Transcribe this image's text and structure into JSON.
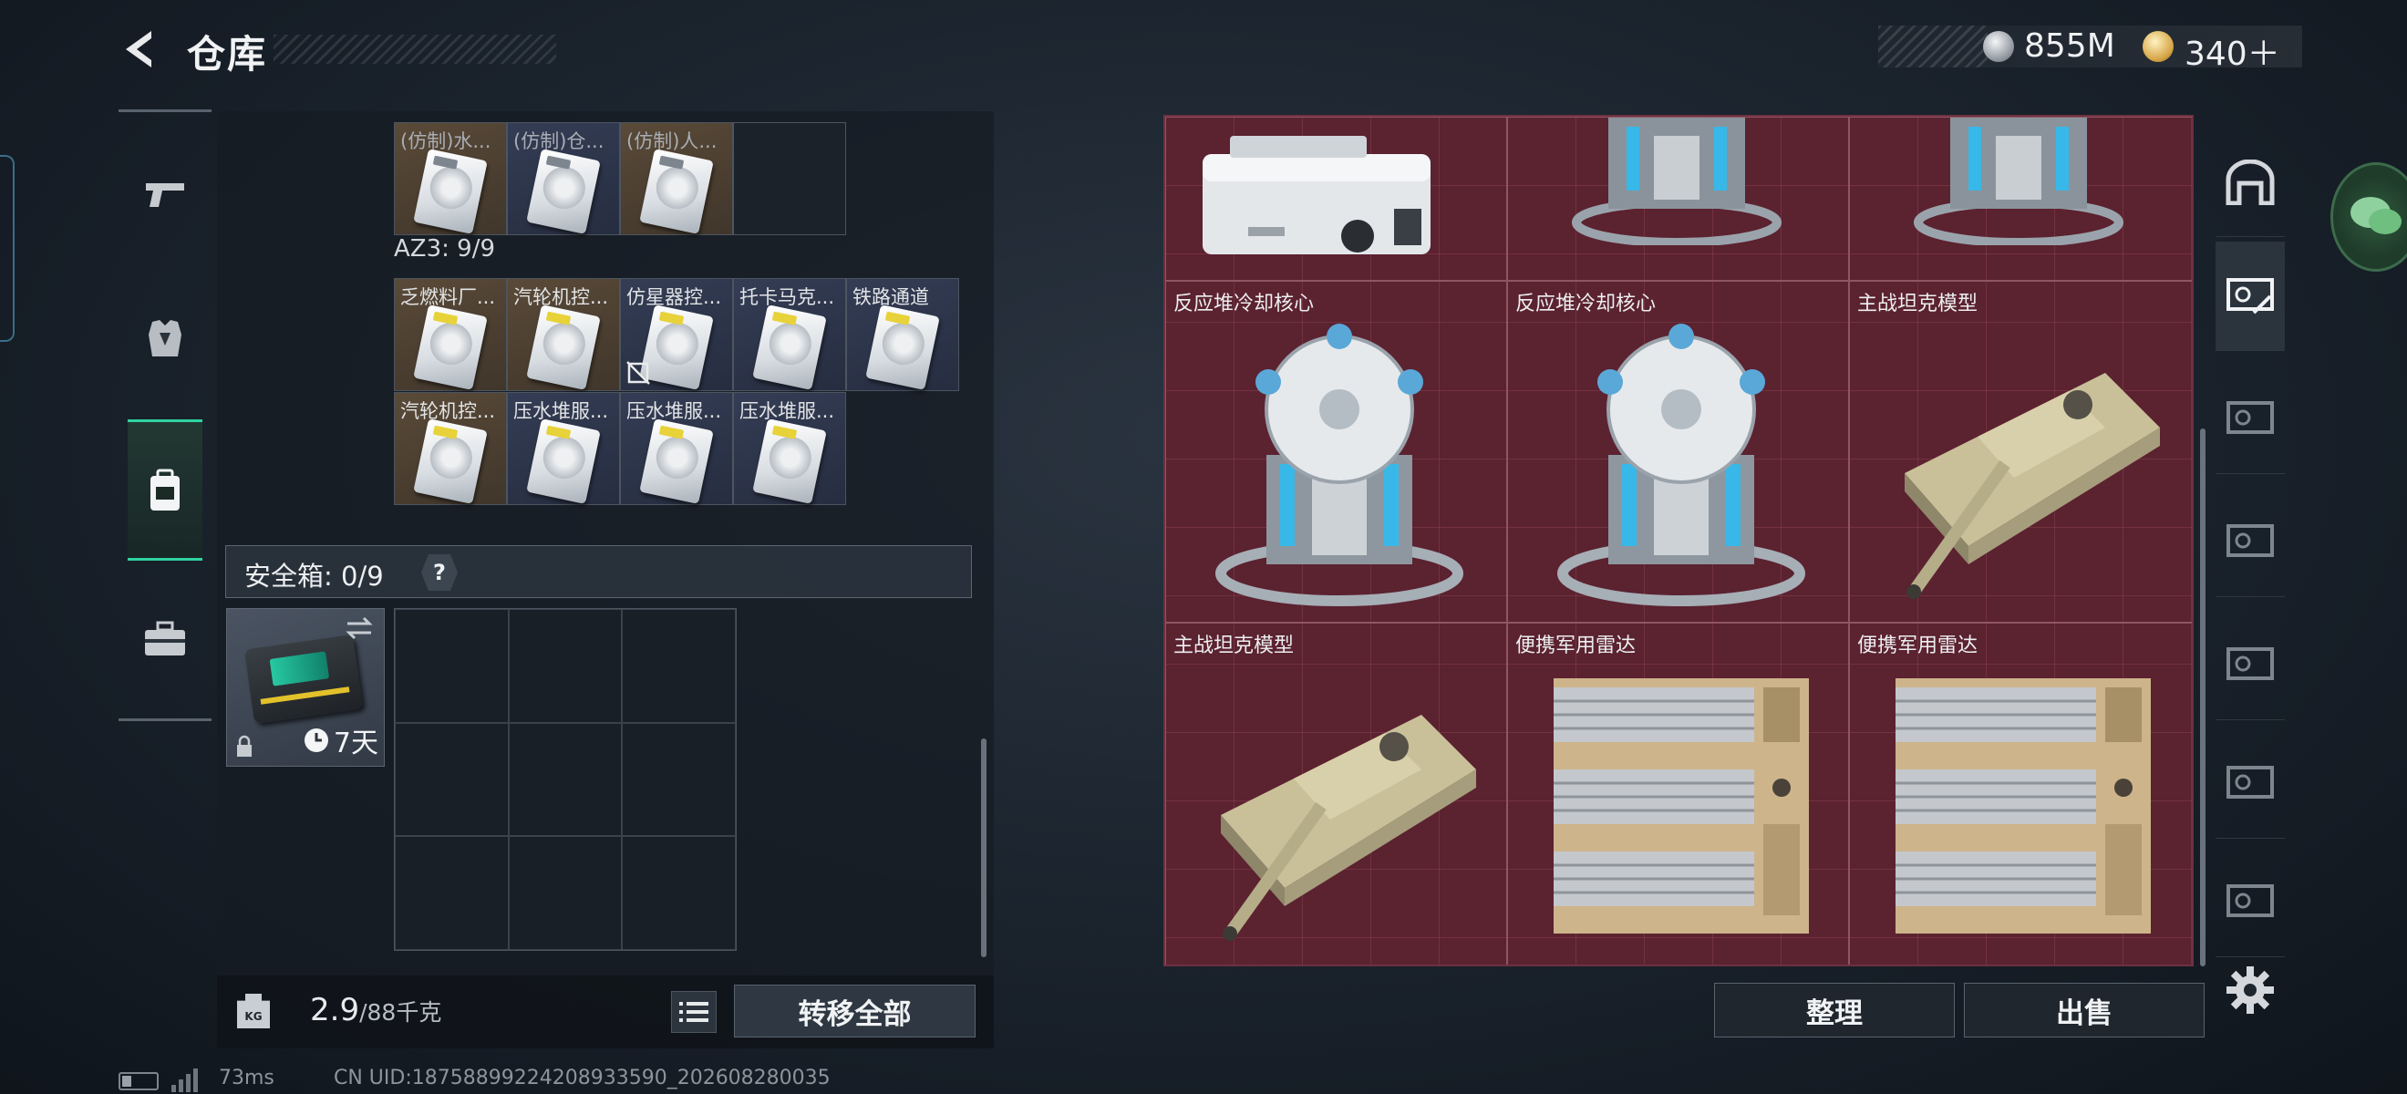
{
  "header": {
    "title": "仓库",
    "back_icon": "back-chevron-icon"
  },
  "currency": {
    "silver": "855M",
    "gold": "340＋",
    "silver_icon": "silver-coin-icon",
    "gold_icon": "gold-coin-icon"
  },
  "left_nav": [
    {
      "id": "weapons",
      "icon": "pistol-icon"
    },
    {
      "id": "armor",
      "icon": "vest-icon"
    },
    {
      "id": "backpack",
      "icon": "backpack-icon",
      "active": true
    },
    {
      "id": "case",
      "icon": "toolbox-icon"
    }
  ],
  "backpack": {
    "top_row": [
      {
        "label": "(仿制)水..."
      },
      {
        "label": "(仿制)仓..."
      },
      {
        "label": "(仿制)人..."
      }
    ],
    "az3_label": "AZ3: 9/9",
    "row1": [
      {
        "label": "乏燃料厂...",
        "color": "brown"
      },
      {
        "label": "汽轮机控...",
        "color": "brown"
      },
      {
        "label": "仿星器控...",
        "color": "navy",
        "no_entry": true
      },
      {
        "label": "托卡马克...",
        "color": "navy"
      },
      {
        "label": "铁路通道",
        "color": "navy"
      }
    ],
    "row2": [
      {
        "label": "汽轮机控...",
        "color": "brown"
      },
      {
        "label": "压水堆服...",
        "color": "navy"
      },
      {
        "label": "压水堆服...",
        "color": "navy"
      },
      {
        "label": "压水堆服...",
        "color": "navy"
      }
    ]
  },
  "safe_box": {
    "label": "安全箱: 0/9",
    "help": "?",
    "timer": "7天"
  },
  "footer": {
    "weight": "2.9",
    "capacity": "/88千克",
    "kg_icon_text": "KG",
    "transfer_all": "转移全部"
  },
  "status": {
    "ping": "73ms",
    "uid": "CN UID:18758899224208933590_202608280035"
  },
  "stash": {
    "items": [
      {
        "label": "",
        "kind": "machine"
      },
      {
        "label": "",
        "kind": "reactor"
      },
      {
        "label": "",
        "kind": "reactor"
      },
      {
        "label": "反应堆冷却核心",
        "kind": "reactor"
      },
      {
        "label": "反应堆冷却核心",
        "kind": "reactor"
      },
      {
        "label": "主战坦克模型",
        "kind": "tank"
      },
      {
        "label": "主战坦克模型",
        "kind": "tank"
      },
      {
        "label": "便携军用雷达",
        "kind": "radar"
      },
      {
        "label": "便携军用雷达",
        "kind": "radar"
      }
    ]
  },
  "right_tabs": [
    {
      "icon": "stash-arch-icon"
    },
    {
      "icon": "stash-page-1-icon",
      "active": true
    },
    {
      "icon": "stash-page-2-icon"
    },
    {
      "icon": "stash-page-3-icon"
    },
    {
      "icon": "stash-page-4-icon"
    },
    {
      "icon": "stash-page-5-icon"
    },
    {
      "icon": "stash-page-6-icon"
    }
  ],
  "actions": {
    "sort": "整理",
    "sell": "出售"
  },
  "colors": {
    "accent": "#2fd3a0",
    "stash_bg": "#5b2230",
    "item_brown": "#5a4a38",
    "item_navy": "#343d55"
  }
}
